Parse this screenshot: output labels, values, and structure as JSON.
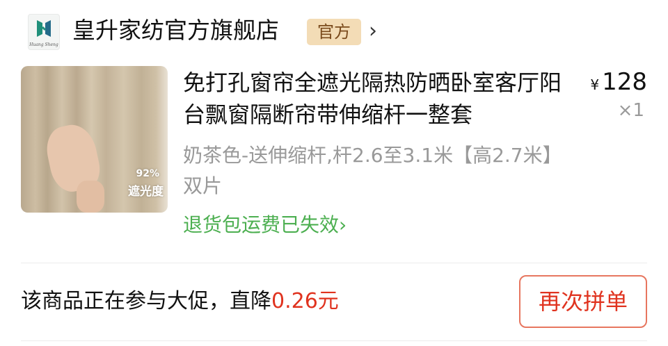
{
  "store": {
    "name": "皇升家纺官方旗舰店",
    "badge": "官方",
    "logo_text": "Huang Sheng"
  },
  "product": {
    "title": "免打孔窗帘全遮光隔热防晒卧室客厅阳台飘窗隔断帘带伸缩杆一整套",
    "price_symbol": "¥",
    "price": "128",
    "quantity": "×1",
    "spec": "奶茶色-送伸缩杆,杆2.6至3.1米【高2.7米】双片",
    "image_overlay": {
      "percent": "92%",
      "label": "遮光度"
    },
    "return_note": "退货包运费已失效",
    "return_chevron": "›"
  },
  "promo": {
    "text": "该商品正在参与大促，直降",
    "amount": "0.26元"
  },
  "actions": {
    "rebuy_label": "再次拼单"
  },
  "colors": {
    "accent_red": "#e0331f",
    "green": "#4caf50",
    "badge_bg": "#f3dcb6"
  }
}
